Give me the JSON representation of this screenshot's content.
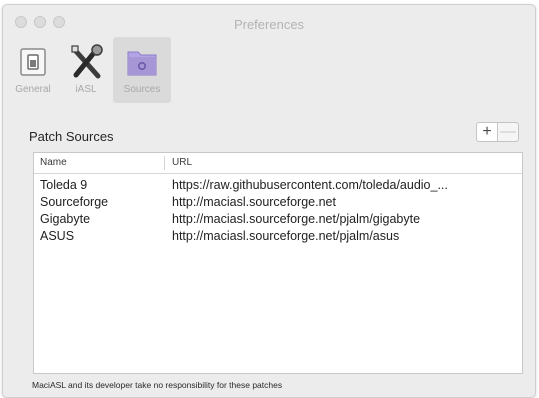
{
  "window": {
    "title": "Preferences"
  },
  "toolbar": {
    "items": [
      {
        "label": "General",
        "icon": "general-switch-icon"
      },
      {
        "label": "iASL",
        "icon": "tools-icon"
      },
      {
        "label": "Sources",
        "icon": "folder-icon"
      }
    ],
    "selected": "Sources"
  },
  "patch_sources": {
    "title": "Patch Sources",
    "add_label": "+",
    "remove_label": "—",
    "columns": [
      "Name",
      "URL"
    ],
    "rows": [
      {
        "name": "Toleda 9",
        "url": "https://raw.githubusercontent.com/toleda/audio_..."
      },
      {
        "name": "Sourceforge",
        "url": "http://maciasl.sourceforge.net"
      },
      {
        "name": "Gigabyte",
        "url": "http://maciasl.sourceforge.net/pjalm/gigabyte"
      },
      {
        "name": "ASUS",
        "url": "http://maciasl.sourceforge.net/pjalm/asus"
      }
    ]
  },
  "footer": {
    "text": "MaciASL and its developer take no responsibility for these patches"
  },
  "colors": {
    "selected_icon": "#a696d6",
    "window_bg": "#ececec"
  }
}
